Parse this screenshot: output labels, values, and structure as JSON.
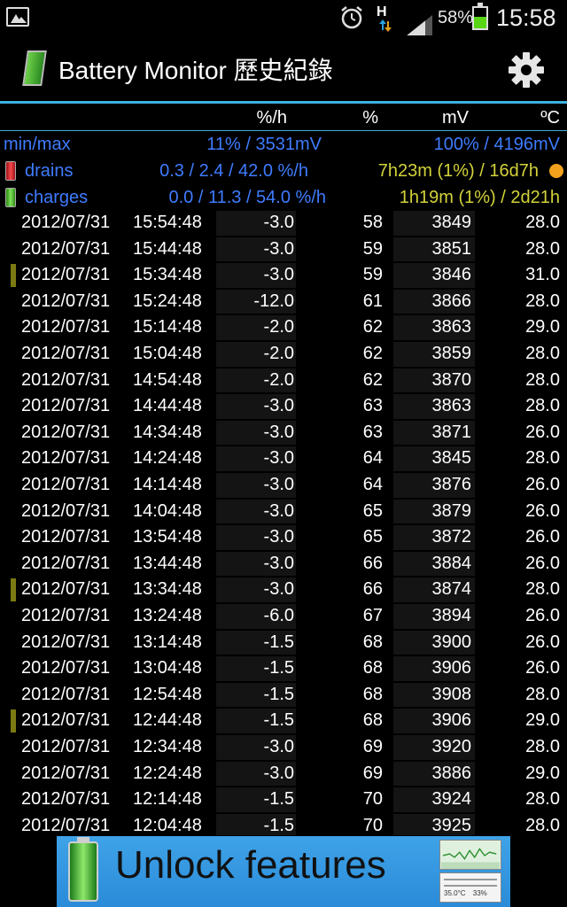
{
  "status_bar": {
    "network": "H",
    "battery_percent": "58%",
    "battery_level": 0.58,
    "time": "15:58",
    "icons": [
      "gallery-icon",
      "alarm-icon",
      "network-arrows-icon",
      "signal-icon",
      "battery-icon"
    ]
  },
  "title_bar": {
    "title": "Battery Monitor 歷史紀錄",
    "icons": [
      "app-battery-icon",
      "gear-icon"
    ]
  },
  "header": {
    "rate": "%/h",
    "percent": "%",
    "mv": "mV",
    "temp": "ºC"
  },
  "summary": {
    "minmax_label": "min/max",
    "minmax_left": "11% / 3531mV",
    "minmax_right": "100% / 4196mV",
    "drains_label": "drains",
    "drains_rates": "0.3 / 2.4 / 42.0 %/h",
    "drains_times": "7h23m (1%) / 16d7h",
    "charges_label": "charges",
    "charges_rates": "0.0 / 11.3 / 54.0 %/h",
    "charges_times": "1h19m (1%) / 2d21h"
  },
  "rows": [
    {
      "date": "2012/07/31",
      "time": "15:54:48",
      "rate": "-3.0",
      "pct": "58",
      "mv": "3849",
      "temp": "28.0",
      "marker": false
    },
    {
      "date": "2012/07/31",
      "time": "15:44:48",
      "rate": "-3.0",
      "pct": "59",
      "mv": "3851",
      "temp": "28.0",
      "marker": false
    },
    {
      "date": "2012/07/31",
      "time": "15:34:48",
      "rate": "-3.0",
      "pct": "59",
      "mv": "3846",
      "temp": "31.0",
      "marker": true
    },
    {
      "date": "2012/07/31",
      "time": "15:24:48",
      "rate": "-12.0",
      "pct": "61",
      "mv": "3866",
      "temp": "28.0",
      "marker": false
    },
    {
      "date": "2012/07/31",
      "time": "15:14:48",
      "rate": "-2.0",
      "pct": "62",
      "mv": "3863",
      "temp": "29.0",
      "marker": false
    },
    {
      "date": "2012/07/31",
      "time": "15:04:48",
      "rate": "-2.0",
      "pct": "62",
      "mv": "3859",
      "temp": "28.0",
      "marker": false
    },
    {
      "date": "2012/07/31",
      "time": "14:54:48",
      "rate": "-2.0",
      "pct": "62",
      "mv": "3870",
      "temp": "28.0",
      "marker": false
    },
    {
      "date": "2012/07/31",
      "time": "14:44:48",
      "rate": "-3.0",
      "pct": "63",
      "mv": "3863",
      "temp": "28.0",
      "marker": false
    },
    {
      "date": "2012/07/31",
      "time": "14:34:48",
      "rate": "-3.0",
      "pct": "63",
      "mv": "3871",
      "temp": "26.0",
      "marker": false
    },
    {
      "date": "2012/07/31",
      "time": "14:24:48",
      "rate": "-3.0",
      "pct": "64",
      "mv": "3845",
      "temp": "28.0",
      "marker": false
    },
    {
      "date": "2012/07/31",
      "time": "14:14:48",
      "rate": "-3.0",
      "pct": "64",
      "mv": "3876",
      "temp": "26.0",
      "marker": false
    },
    {
      "date": "2012/07/31",
      "time": "14:04:48",
      "rate": "-3.0",
      "pct": "65",
      "mv": "3879",
      "temp": "26.0",
      "marker": false
    },
    {
      "date": "2012/07/31",
      "time": "13:54:48",
      "rate": "-3.0",
      "pct": "65",
      "mv": "3872",
      "temp": "26.0",
      "marker": false
    },
    {
      "date": "2012/07/31",
      "time": "13:44:48",
      "rate": "-3.0",
      "pct": "66",
      "mv": "3884",
      "temp": "26.0",
      "marker": false
    },
    {
      "date": "2012/07/31",
      "time": "13:34:48",
      "rate": "-3.0",
      "pct": "66",
      "mv": "3874",
      "temp": "28.0",
      "marker": true
    },
    {
      "date": "2012/07/31",
      "time": "13:24:48",
      "rate": "-6.0",
      "pct": "67",
      "mv": "3894",
      "temp": "26.0",
      "marker": false
    },
    {
      "date": "2012/07/31",
      "time": "13:14:48",
      "rate": "-1.5",
      "pct": "68",
      "mv": "3900",
      "temp": "26.0",
      "marker": false
    },
    {
      "date": "2012/07/31",
      "time": "13:04:48",
      "rate": "-1.5",
      "pct": "68",
      "mv": "3906",
      "temp": "26.0",
      "marker": false
    },
    {
      "date": "2012/07/31",
      "time": "12:54:48",
      "rate": "-1.5",
      "pct": "68",
      "mv": "3908",
      "temp": "28.0",
      "marker": false
    },
    {
      "date": "2012/07/31",
      "time": "12:44:48",
      "rate": "-1.5",
      "pct": "68",
      "mv": "3906",
      "temp": "29.0",
      "marker": true
    },
    {
      "date": "2012/07/31",
      "time": "12:34:48",
      "rate": "-3.0",
      "pct": "69",
      "mv": "3920",
      "temp": "28.0",
      "marker": false
    },
    {
      "date": "2012/07/31",
      "time": "12:24:48",
      "rate": "-3.0",
      "pct": "69",
      "mv": "3886",
      "temp": "29.0",
      "marker": false
    },
    {
      "date": "2012/07/31",
      "time": "12:14:48",
      "rate": "-1.5",
      "pct": "70",
      "mv": "3924",
      "temp": "28.0",
      "marker": false
    },
    {
      "date": "2012/07/31",
      "time": "12:04:48",
      "rate": "-1.5",
      "pct": "70",
      "mv": "3925",
      "temp": "28.0",
      "marker": false
    }
  ],
  "ad": {
    "text": "Unlock features",
    "thumb_temp": "35.0°C",
    "thumb_pct": "33%"
  },
  "colors": {
    "accent": "#3db2e0",
    "summary_blue": "#3f7cff",
    "summary_yellow": "#d2d23a",
    "marker": "#7c7a12",
    "ad_background": "#2a8bd8"
  }
}
